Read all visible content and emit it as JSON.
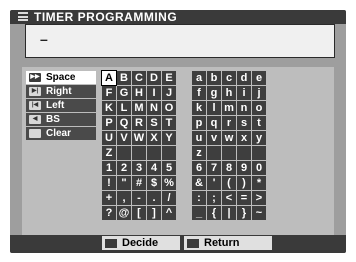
{
  "title": "TIMER PROGRAMMING",
  "input": {
    "value": "–"
  },
  "sidebar": {
    "items": [
      {
        "label": "Space",
        "icon": "▶▶"
      },
      {
        "label": "Right",
        "icon": "▶|"
      },
      {
        "label": "Left",
        "icon": "|◀"
      },
      {
        "label": "BS",
        "icon": "◀"
      },
      {
        "label": "Clear",
        "icon": ""
      }
    ]
  },
  "keyboard": {
    "selected": "A",
    "rows": [
      [
        "A",
        "B",
        "C",
        "D",
        "E",
        "",
        "a",
        "b",
        "c",
        "d",
        "e"
      ],
      [
        "F",
        "G",
        "H",
        "I",
        "J",
        "",
        "f",
        "g",
        "h",
        "i",
        "j"
      ],
      [
        "K",
        "L",
        "M",
        "N",
        "O",
        "",
        "k",
        "l",
        "m",
        "n",
        "o"
      ],
      [
        "P",
        "Q",
        "R",
        "S",
        "T",
        "",
        "p",
        "q",
        "r",
        "s",
        "t"
      ],
      [
        "U",
        "V",
        "W",
        "X",
        "Y",
        "",
        "u",
        "v",
        "w",
        "x",
        "y"
      ],
      [
        "Z",
        "",
        "",
        "",
        "",
        "",
        "z",
        "",
        "",
        "",
        ""
      ],
      [
        "1",
        "2",
        "3",
        "4",
        "5",
        "",
        "6",
        "7",
        "8",
        "9",
        "0"
      ],
      [
        "!",
        "\"",
        "#",
        "$",
        "%",
        "",
        "&",
        "'",
        "(",
        ")",
        "*"
      ],
      [
        "+",
        ",",
        "-",
        ".",
        "/",
        "",
        ":",
        ";",
        "<",
        "=",
        ">"
      ],
      [
        "?",
        "@",
        "[",
        "]",
        "^",
        "",
        "_",
        "{",
        "|",
        "}",
        "~"
      ]
    ]
  },
  "buttons": {
    "decide": "Decide",
    "return": "Return"
  }
}
